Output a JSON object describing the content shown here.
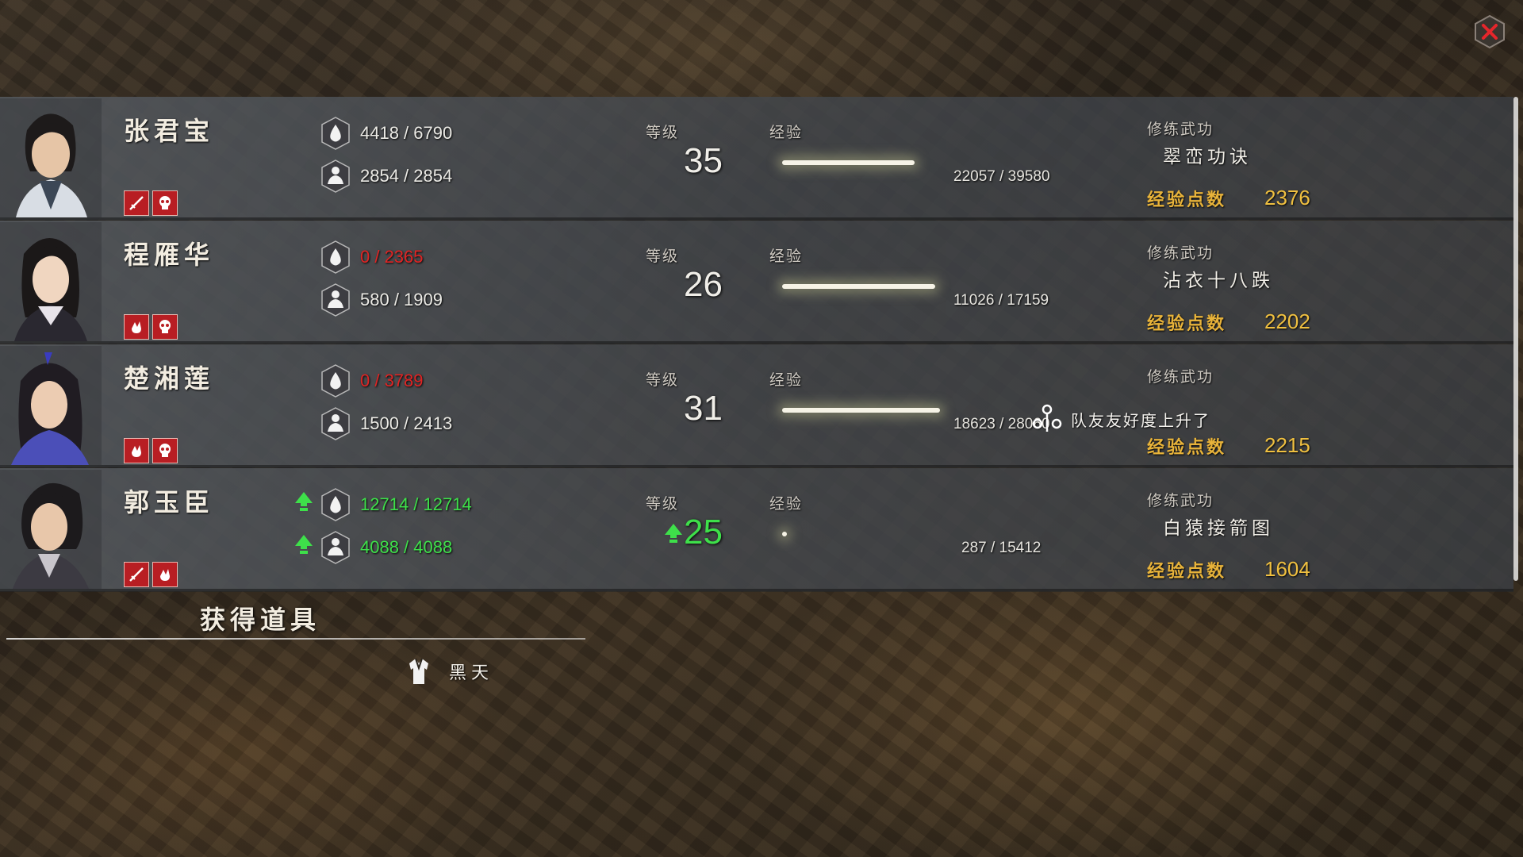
{
  "labels": {
    "level": "等级",
    "exp": "经验",
    "skill": "修练武功",
    "points": "经验点数"
  },
  "characters": [
    {
      "name": "张君宝",
      "hp": "4418 / 6790",
      "mp": "2854 / 2854",
      "level": "35",
      "exp": "22057 / 39580",
      "exp_fraction": 0.557,
      "skill": "翠峦功诀",
      "points": "2376"
    },
    {
      "name": "程雁华",
      "hp": "0 / 2365",
      "mp": "580 / 1909",
      "level": "26",
      "exp": "11026 / 17159",
      "exp_fraction": 0.643,
      "skill": "沾衣十八跌",
      "points": "2202"
    },
    {
      "name": "楚湘莲",
      "hp": "0 / 3789",
      "mp": "1500 / 2413",
      "level": "31",
      "exp": "18623 / 28060",
      "exp_fraction": 0.664,
      "skill": "",
      "points": "2215"
    },
    {
      "name": "郭玉臣",
      "hp": "12714 / 12714",
      "mp": "4088 / 4088",
      "level": "25",
      "exp": "287 / 15412",
      "exp_fraction": 0.019,
      "skill": "白猿接箭图",
      "points": "1604"
    }
  ],
  "notice": "队友友好度上升了",
  "items": {
    "title": "获得道具",
    "list": [
      "黑天"
    ]
  },
  "colors": {
    "points": "#f0c040",
    "points_label": "#e8b33a",
    "zero_hp": "#e02424",
    "level_up": "#3ee04a",
    "tag": "#b81e23"
  },
  "icons": [
    "close-icon",
    "hp-drop-icon",
    "mp-person-icon",
    "sword-tag-icon",
    "skull-tag-icon",
    "fist-tag-icon",
    "level-up-arrow-icon",
    "friendship-icon",
    "robe-item-icon"
  ]
}
